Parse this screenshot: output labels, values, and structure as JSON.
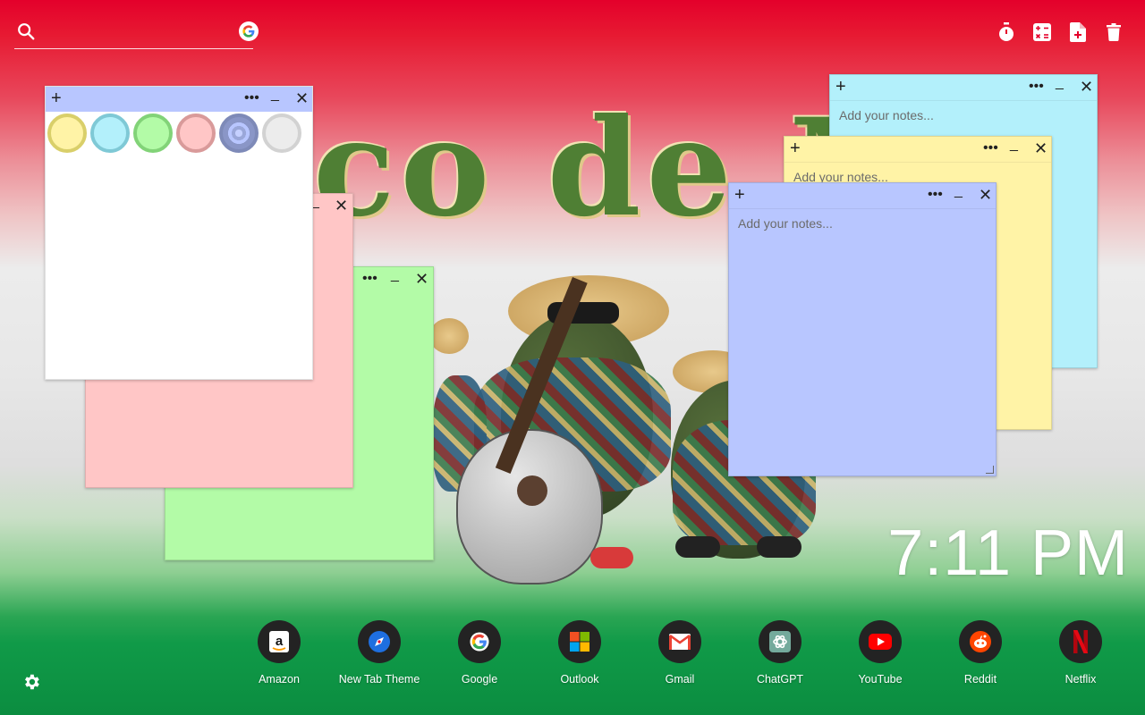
{
  "background": {
    "title_fragment": "co de M"
  },
  "search": {
    "placeholder": ""
  },
  "notes": {
    "placeholder": "Add your notes...",
    "colors": {
      "yellow": "#fff3a6",
      "cyan": "#b3f0fb",
      "green": "#b3fba7",
      "pink": "#ffc6c6",
      "blue": "#b8c6ff",
      "white": "#ffffff"
    }
  },
  "clock": {
    "time": "7:11 PM"
  },
  "dock": {
    "items": [
      {
        "label": "Amazon",
        "icon": "amazon-icon"
      },
      {
        "label": "New Tab Theme",
        "icon": "new-tab-theme-icon"
      },
      {
        "label": "Google",
        "icon": "google-icon"
      },
      {
        "label": "Outlook",
        "icon": "outlook-icon"
      },
      {
        "label": "Gmail",
        "icon": "gmail-icon"
      },
      {
        "label": "ChatGPT",
        "icon": "chatgpt-icon"
      },
      {
        "label": "YouTube",
        "icon": "youtube-icon"
      },
      {
        "label": "Reddit",
        "icon": "reddit-icon"
      },
      {
        "label": "Netflix",
        "icon": "netflix-icon"
      }
    ]
  }
}
